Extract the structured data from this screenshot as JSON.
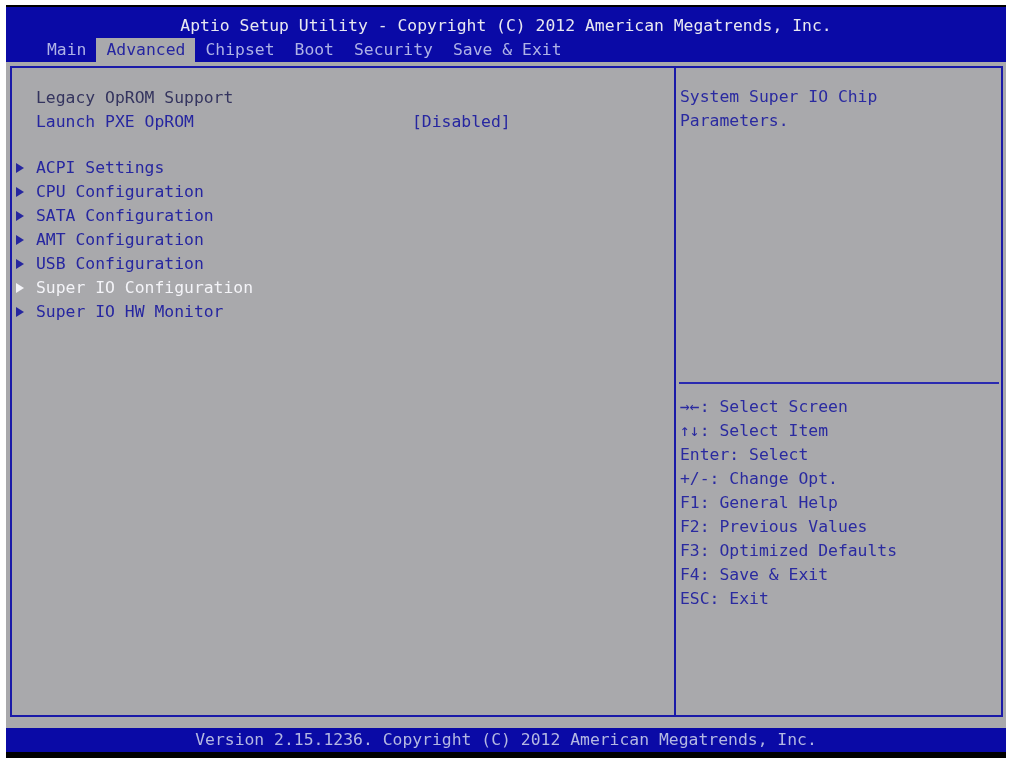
{
  "header": {
    "title": "Aptio Setup Utility - Copyright (C) 2012 American Megatrends, Inc.",
    "tabs": [
      {
        "label": "Main",
        "selected": false
      },
      {
        "label": "Advanced",
        "selected": true
      },
      {
        "label": "Chipset",
        "selected": false
      },
      {
        "label": "Boot",
        "selected": false
      },
      {
        "label": "Security",
        "selected": false
      },
      {
        "label": "Save & Exit",
        "selected": false
      }
    ]
  },
  "settings": {
    "sections": [
      {
        "items": [
          {
            "kind": "heading",
            "label": "Legacy OpROM Support",
            "selected": false
          },
          {
            "kind": "option",
            "label": "Launch PXE OpROM",
            "value": "[Disabled]",
            "selected": false
          }
        ]
      },
      {
        "items": [
          {
            "kind": "submenu",
            "label": "ACPI Settings",
            "selected": false
          },
          {
            "kind": "submenu",
            "label": "CPU Configuration",
            "selected": false
          },
          {
            "kind": "submenu",
            "label": "SATA Configuration",
            "selected": false
          },
          {
            "kind": "submenu",
            "label": "AMT Configuration",
            "selected": false
          },
          {
            "kind": "submenu",
            "label": "USB Configuration",
            "selected": false
          },
          {
            "kind": "submenu",
            "label": "Super IO Configuration",
            "selected": true
          },
          {
            "kind": "submenu",
            "label": "Super IO HW Monitor",
            "selected": false
          }
        ]
      }
    ]
  },
  "help": {
    "text": "System Super IO Chip Parameters.",
    "key_hints": [
      "→←: Select Screen",
      "↑↓: Select Item",
      "Enter: Select",
      "+/-: Change Opt.",
      "F1: General Help",
      "F2: Previous Values",
      "F3: Optimized Defaults",
      "F4: Save & Exit",
      "ESC: Exit"
    ]
  },
  "footer": {
    "text": "Version 2.15.1236. Copyright (C) 2012 American Megatrends, Inc."
  }
}
